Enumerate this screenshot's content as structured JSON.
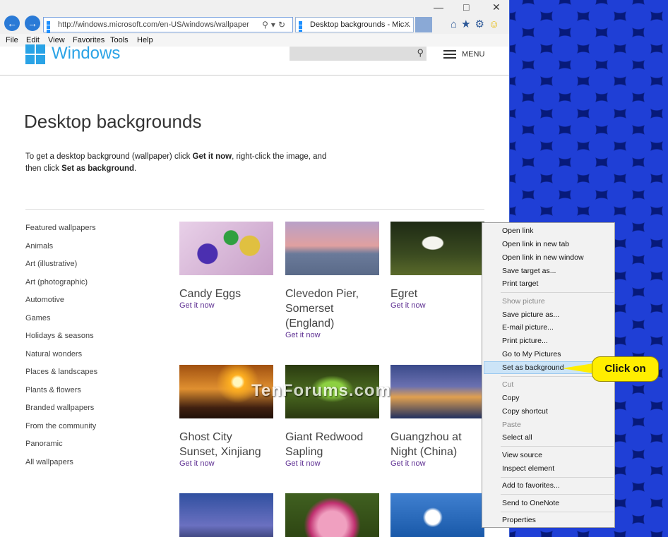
{
  "browser": {
    "address_url": "http://windows.microsoft.com/en-US/windows/wallpaper",
    "tab_title": "Desktop backgrounds - Mic...",
    "menu": [
      "File",
      "Edit",
      "View",
      "Favorites",
      "Tools",
      "Help"
    ]
  },
  "site": {
    "brand": "Windows",
    "menu_label": "MENU"
  },
  "page": {
    "title": "Desktop backgrounds",
    "intro_1": "To get a desktop background (wallpaper) click ",
    "intro_b1": "Get it now",
    "intro_2": ", right-click the image, and then click ",
    "intro_b2": "Set as background",
    "intro_3": "."
  },
  "sidebar": [
    "Featured wallpapers",
    "Animals",
    "Art (illustrative)",
    "Art (photographic)",
    "Automotive",
    "Games",
    "Holidays & seasons",
    "Natural wonders",
    "Places & landscapes",
    "Plants & flowers",
    "Branded wallpapers",
    "From the community",
    "Panoramic",
    "All wallpapers"
  ],
  "tiles": [
    {
      "name": "Candy Eggs",
      "link": "Get it now"
    },
    {
      "name": "Clevedon Pier, Somerset (England)",
      "link": "Get it now"
    },
    {
      "name": "Egret",
      "link": "Get it now"
    },
    {
      "name": "Ghost City Sunset, Xinjiang",
      "link": "Get it now"
    },
    {
      "name": "Giant Redwood Sapling",
      "link": "Get it now"
    },
    {
      "name": "Guangzhou at Night (China)",
      "link": "Get it now"
    }
  ],
  "context_menu": {
    "open_link": "Open link",
    "open_link_new_tab": "Open link in new tab",
    "open_link_new_window": "Open link in new window",
    "save_target_as": "Save target as...",
    "print_target": "Print target",
    "show_picture": "Show picture",
    "save_picture_as": "Save picture as...",
    "email_picture": "E-mail picture...",
    "print_picture": "Print picture...",
    "go_to_my_pictures": "Go to My Pictures",
    "set_as_background": "Set as background",
    "cut": "Cut",
    "copy": "Copy",
    "copy_shortcut": "Copy shortcut",
    "paste": "Paste",
    "select_all": "Select all",
    "view_source": "View source",
    "inspect_element": "Inspect element",
    "add_to_favorites": "Add to favorites...",
    "send_to_onenote": "Send to OneNote",
    "properties": "Properties"
  },
  "callout": "Click on",
  "watermark": "TenForums.com",
  "colors": {
    "accent": "#2aa3e6",
    "link": "#5c2d91",
    "callout": "#ffee00",
    "menu_highlight": "#cce4f7"
  }
}
